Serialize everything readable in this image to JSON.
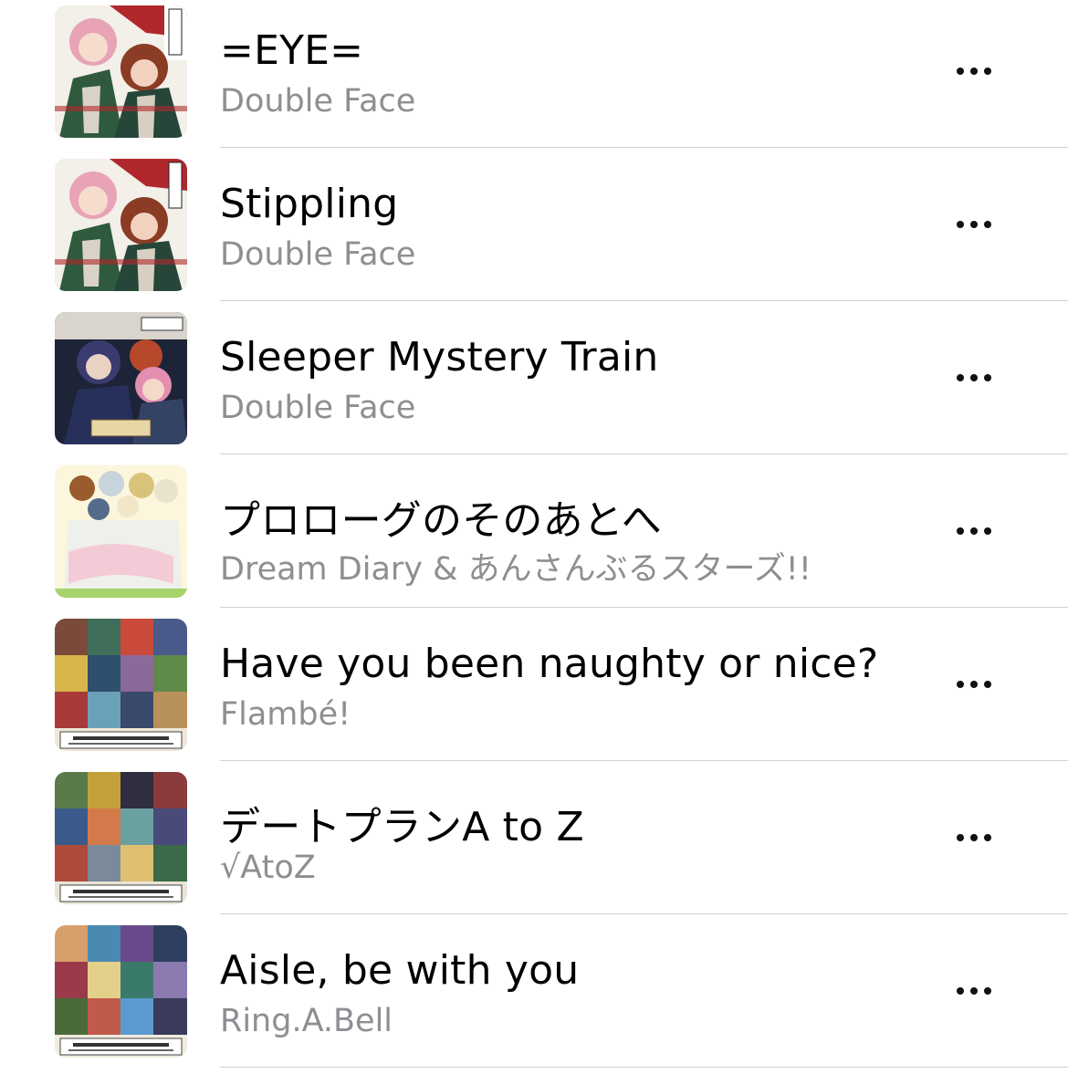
{
  "songs": [
    {
      "title": "=EYE=",
      "artist": "Double Face",
      "artwork": "double-face-single-artwork"
    },
    {
      "title": "Stippling",
      "artist": "Double Face",
      "artwork": "double-face-single-artwork"
    },
    {
      "title": "Sleeper Mystery Train",
      "artist": "Double Face",
      "artwork": "double-face-album-artwork"
    },
    {
      "title": "プロローグのそのあとへ",
      "artist": "Dream Diary & あんさんぶるスターズ!!",
      "artwork": "prologue-artwork"
    },
    {
      "title": "Have you been naughty or nice?",
      "artist": "Flambé!",
      "artwork": "shuffle-unit-vol03-artwork"
    },
    {
      "title": "デートプランA to Z",
      "artist": "√AtoZ",
      "artwork": "shuffle-unit-vol01-artwork"
    },
    {
      "title": "Aisle, be with you",
      "artist": "Ring.A.Bell",
      "artwork": "shuffle-unit-vol02-artwork"
    }
  ],
  "more_button_icon": "ellipsis-icon",
  "colors": {
    "title": "#000000",
    "artist": "#8e8e93",
    "separator": "#d1d1d6",
    "background": "#ffffff"
  }
}
